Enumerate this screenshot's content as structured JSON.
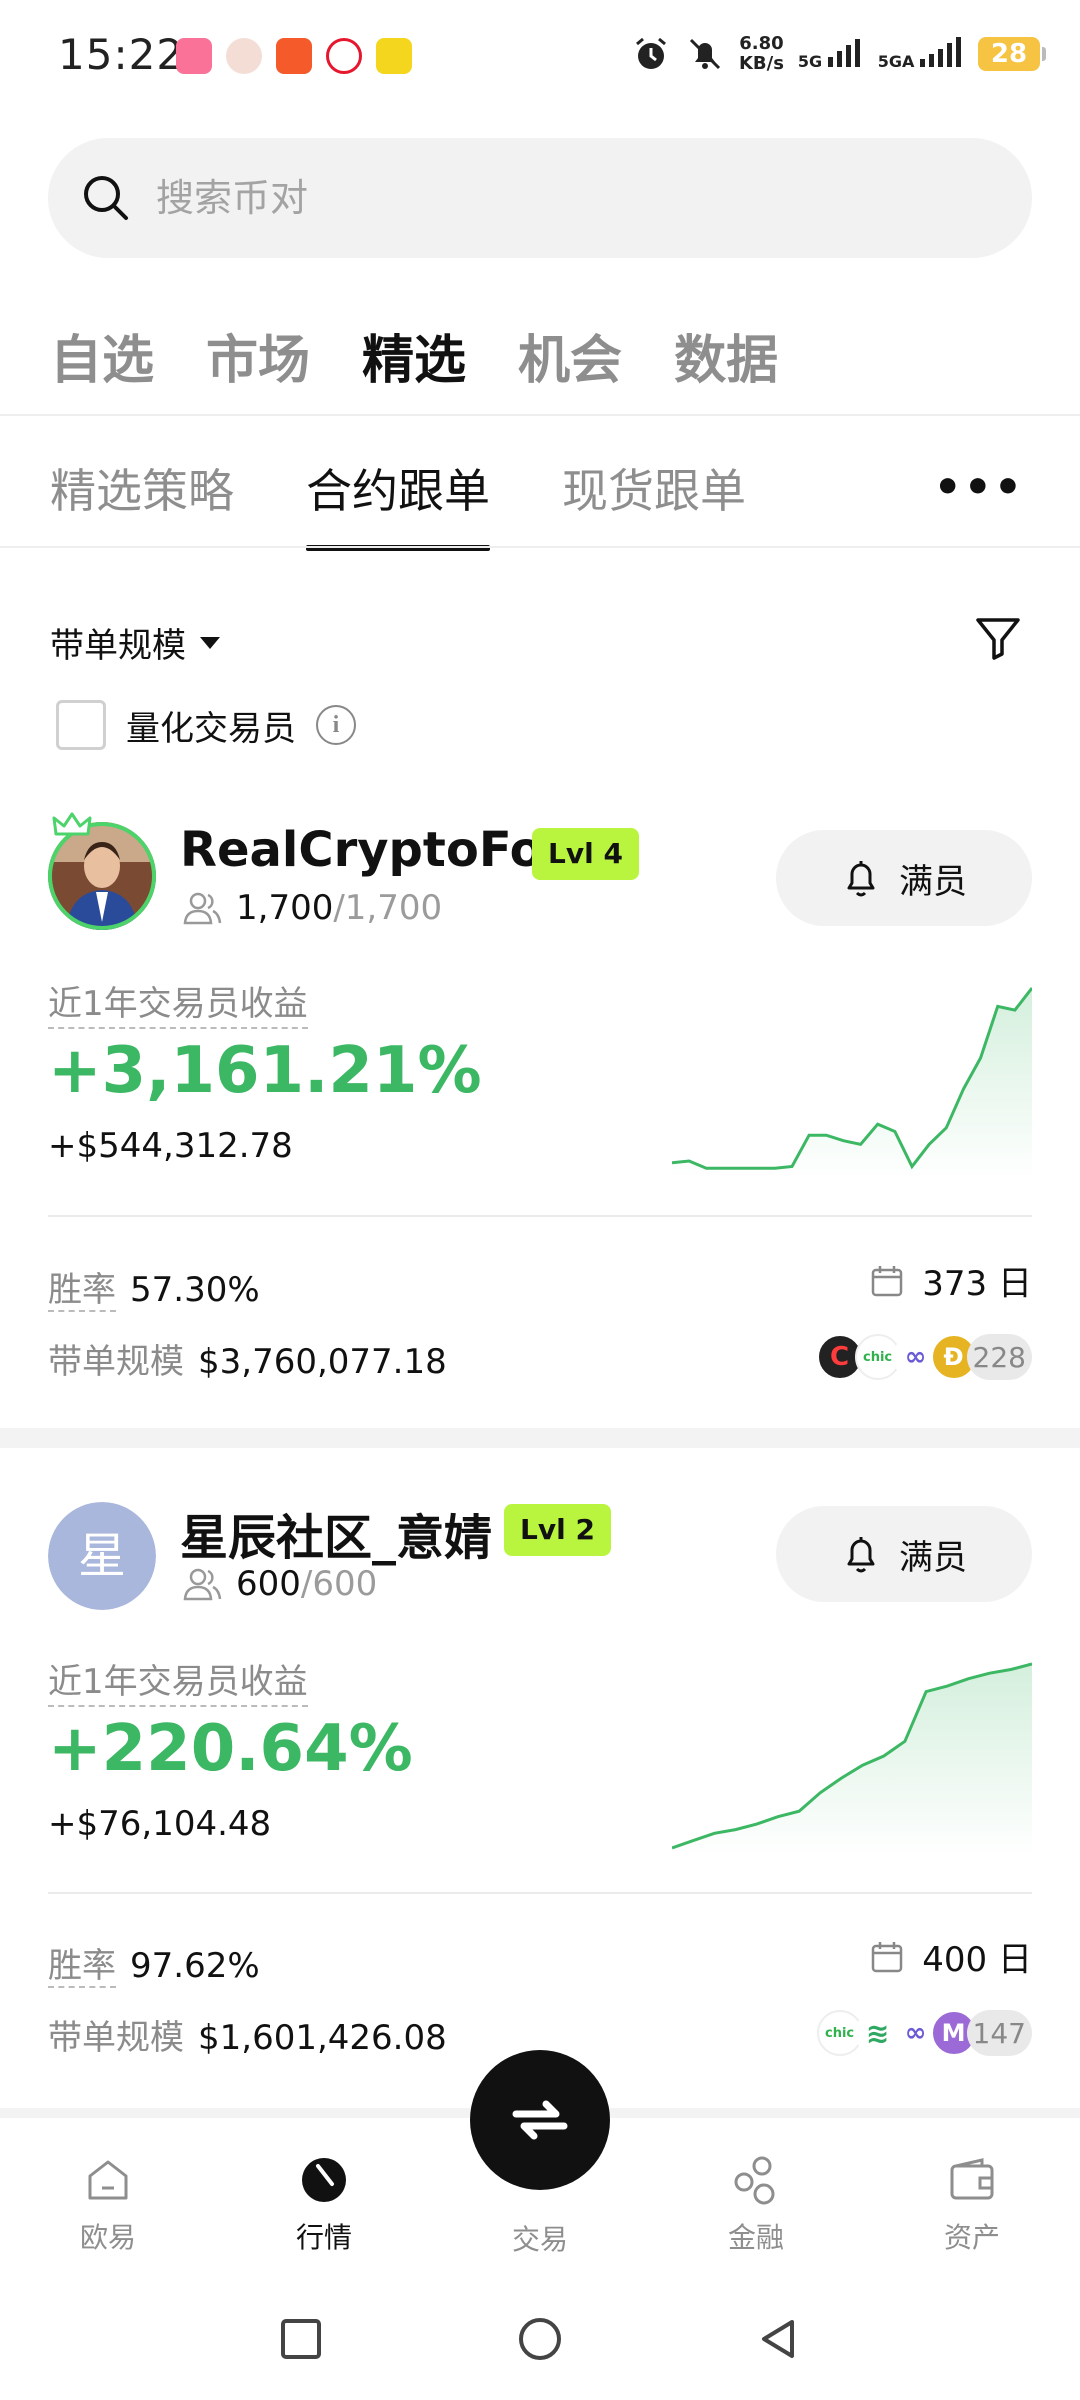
{
  "status_bar": {
    "time": "15:22",
    "net_speed_value": "6.80",
    "net_speed_unit": "KB/s",
    "network1": "5G",
    "network2": "5GA",
    "battery": "28"
  },
  "search": {
    "placeholder": "搜索币对"
  },
  "top_tabs": [
    {
      "label": "自选",
      "active": false
    },
    {
      "label": "市场",
      "active": false
    },
    {
      "label": "精选",
      "active": true
    },
    {
      "label": "机会",
      "active": false
    },
    {
      "label": "数据",
      "active": false
    }
  ],
  "sub_tabs": [
    {
      "label": "精选策略",
      "active": false
    },
    {
      "label": "合约跟单",
      "active": true
    },
    {
      "label": "现货跟单",
      "active": false
    }
  ],
  "more_label": "•••",
  "filters": {
    "scale_label": "带单规模",
    "quant_label": "量化交易员",
    "info_glyph": "i"
  },
  "traders": [
    {
      "name": "RealCryptoFox",
      "level": "Lvl 4",
      "followers": "1,700",
      "followers_max": "/1,700",
      "button_label": "满员",
      "roi_label": "近1年交易员收益",
      "roi": "+3,161.21%",
      "pnl": "+$544,312.78",
      "win_rate_label": "胜率",
      "win_rate": "57.30%",
      "days": "373 日",
      "aum_label": "带单规模",
      "aum": "$3,760,077.18",
      "coin_count": "228",
      "coins": [
        {
          "name": "coin-c",
          "text": "C",
          "bg": "#222222",
          "fg": "#ff3b3b"
        },
        {
          "name": "coin-chic",
          "text": "chic",
          "bg": "#ffffff",
          "fg": "#2fb24c"
        },
        {
          "name": "coin-infinity",
          "text": "∞",
          "bg": "#ffffff",
          "fg": "#6b5bd6"
        },
        {
          "name": "coin-doge",
          "text": "Ð",
          "bg": "#e6b422",
          "fg": "#ffffff"
        }
      ],
      "sparkline": [
        0.05,
        0.06,
        0.02,
        0.02,
        0.02,
        0.02,
        0.02,
        0.03,
        0.2,
        0.2,
        0.17,
        0.15,
        0.26,
        0.22,
        0.03,
        0.15,
        0.24,
        0.45,
        0.62,
        0.9,
        0.88,
        1.0
      ]
    },
    {
      "name": "星辰社区_意婧",
      "avatar_letter": "星",
      "level": "Lvl 2",
      "followers": "600",
      "followers_max": "/600",
      "button_label": "满员",
      "roi_label": "近1年交易员收益",
      "roi": "+220.64%",
      "pnl": "+$76,104.48",
      "win_rate_label": "胜率",
      "win_rate": "97.62%",
      "days": "400 日",
      "aum_label": "带单规模",
      "aum": "$1,601,426.08",
      "coin_count": "147",
      "coins": [
        {
          "name": "coin-chic",
          "text": "chic",
          "bg": "#ffffff",
          "fg": "#2fb24c"
        },
        {
          "name": "coin-waves",
          "text": "≋",
          "bg": "#ffffff",
          "fg": "#2fa864"
        },
        {
          "name": "coin-infinity",
          "text": "∞",
          "bg": "#ffffff",
          "fg": "#6b5bd6"
        },
        {
          "name": "coin-m",
          "text": "M",
          "bg": "#9b6ad6",
          "fg": "#ffffff"
        }
      ],
      "sparkline": [
        0.0,
        0.04,
        0.08,
        0.1,
        0.13,
        0.17,
        0.2,
        0.3,
        0.38,
        0.45,
        0.5,
        0.58,
        0.85,
        0.88,
        0.92,
        0.95,
        0.97,
        1.0
      ]
    }
  ],
  "bottom_nav": [
    {
      "label": "欧易",
      "icon": "home-icon",
      "active": false
    },
    {
      "label": "行情",
      "icon": "market-icon",
      "active": true
    },
    {
      "label": "交易",
      "icon": "trade-icon",
      "active": false
    },
    {
      "label": "金融",
      "icon": "finance-icon",
      "active": false
    },
    {
      "label": "资产",
      "icon": "wallet-icon",
      "active": false
    }
  ],
  "colors": {
    "accent_green": "#3cb763",
    "level_badge": "#b9f53f",
    "text_primary": "#111111",
    "text_secondary": "#8e8e8e"
  }
}
